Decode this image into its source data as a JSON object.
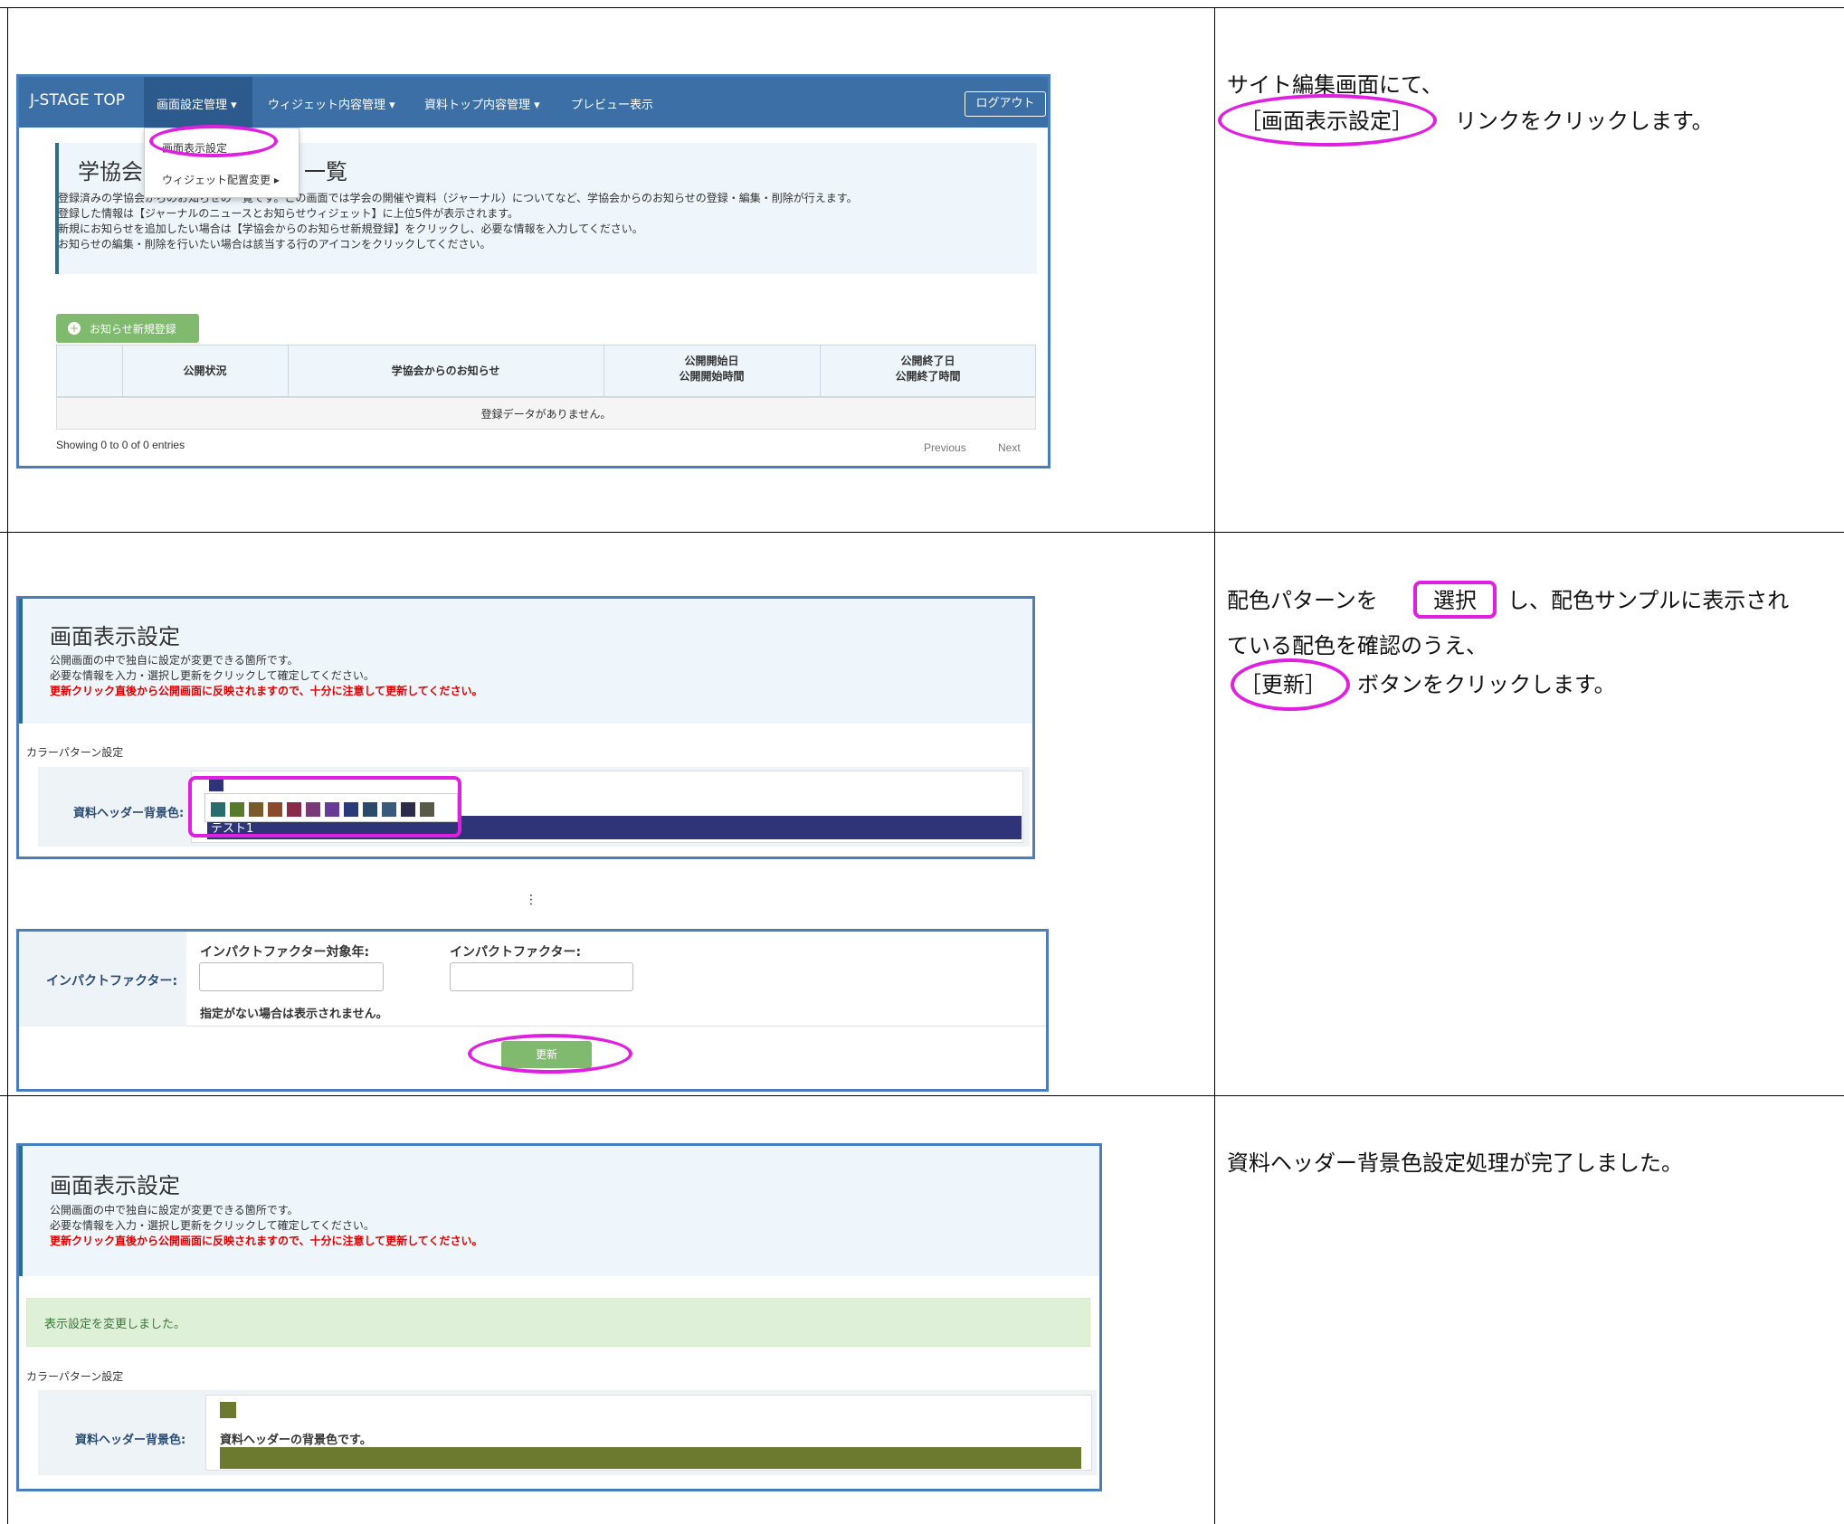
{
  "row1": {
    "nav": {
      "brand": "J-STAGE TOP",
      "items": [
        "画面設定管理 ▾",
        "ウィジェット内容管理 ▾",
        "資料トップ内容管理 ▾",
        "プレビュー表示"
      ],
      "logout": "ログアウト"
    },
    "dropdown": [
      "画面表示設定",
      "ウィジェット配置変更 ▸"
    ],
    "page_title_left": "学協会",
    "page_title_right": "一覧",
    "desc_lines": [
      "登録済みの学協会からのお知らせの一覧です。この画面では学会の開催や資料（ジャーナル）についてなど、学協会からのお知らせの登録・編集・削除が行えます。",
      "登録した情報は【ジャーナルのニュースとお知らせウィジェット】に上位5件が表示されます。",
      "新規にお知らせを追加したい場合は【学協会からのお知らせ新規登録】をクリックし、必要な情報を入力してください。",
      "お知らせの編集・削除を行いたい場合は該当する行のアイコンをクリックしてください。"
    ],
    "add_button": "お知らせ新規登録",
    "table_headers": [
      "公開状況",
      "学協会からのお知らせ",
      "公開開始日",
      "公開開始時間",
      "公開終了日",
      "公開終了時間"
    ],
    "empty_message": "登録データがありません。",
    "showing": "Showing 0 to 0 of 0 entries",
    "previous": "Previous",
    "next": "Next",
    "instruction_line1": "サイト編集画面にて、",
    "instruction_line2_link": "［画面表示設定］",
    "instruction_line2_rest": "リンクをクリックします。"
  },
  "row2": {
    "title": "画面表示設定",
    "desc1": "公開画面の中で独自に設定が変更できる箇所です。",
    "desc2": "必要な情報を入力・選択し更新をクリックして確定してください。",
    "warn": "更新クリック直後から公開画面に反映されますので、十分に注意して更新してください。",
    "section": "カラーパターン設定",
    "field_label": "資料ヘッダー背景色:",
    "sample_text": "テスト1",
    "palette": [
      "#2a6b6e",
      "#5a7a2b",
      "#7a5a2b",
      "#8a4a2b",
      "#8a2b4a",
      "#7a3a7a",
      "#6a3a9a",
      "#2b3a7a",
      "#2b4a6a",
      "#3a5a7a",
      "#2b2b4a",
      "#5a5a4a"
    ],
    "header_color": "#2e3477",
    "ellipsis": "⋮",
    "impact_label": "インパクトファクター:",
    "impact_year_label": "インパクトファクター対象年:",
    "impact_value_label": "インパクトファクター:",
    "impact_note": "指定がない場合は表示されません。",
    "update_button": "更新",
    "instr_a": "配色パターンを",
    "instr_select": "選択",
    "instr_b": "し、配色サンプルに表示され",
    "instr_c": "ている配色を確認のうえ、",
    "instr_update": "［更新］",
    "instr_d": "ボタンをクリックします。"
  },
  "row3": {
    "title": "画面表示設定",
    "desc1": "公開画面の中で独自に設定が変更できる箇所です。",
    "desc2": "必要な情報を入力・選択し更新をクリックして確定してください。",
    "warn": "更新クリック直後から公開画面に反映されますので、十分に注意して更新してください。",
    "success": "表示設定を変更しました。",
    "section": "カラーパターン設定",
    "field_label": "資料ヘッダー背景色:",
    "field_text": "資料ヘッダーの背景色です。",
    "color": "#6b7a2e",
    "instruction": "資料ヘッダー背景色設定処理が完了しました。"
  }
}
